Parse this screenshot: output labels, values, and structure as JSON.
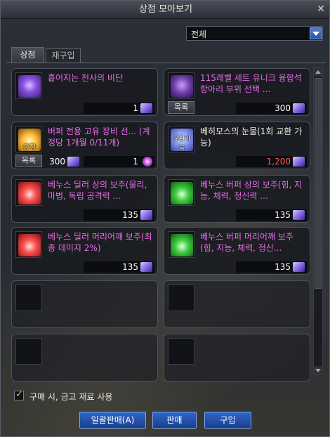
{
  "window": {
    "title": "상점 모아보기"
  },
  "filter": {
    "value": "전체"
  },
  "tabs": [
    {
      "label": "상점"
    },
    {
      "label": "재구입"
    }
  ],
  "items": [
    {
      "name": "흩어지는 천사의 비단",
      "price": "1",
      "icon": "angel-silk-icon"
    },
    {
      "name": "115레벨 세트 유니크 융합석 항아리 부위 선택 ...",
      "price": "300",
      "list_label": "목록",
      "icon": "fusion-stone-jar-icon"
    },
    {
      "name": "버퍼 전용 고유 장비 선... (계정당 1개월 0/11개)",
      "price": "1",
      "list_label": "목록",
      "left_price": "300",
      "icon_label": "한정",
      "icon": "buffer-equipment-chest-icon"
    },
    {
      "name": "베히모스의 눈물(1회 교환 가능)",
      "price": "1,200",
      "icon_label": "교환가능",
      "icon": "behemoth-tear-icon"
    },
    {
      "name": "베누스 딜러 상의 보주(물리, 마법, 독립 공격력 ...",
      "price": "135",
      "icon": "venus-dealer-top-orb-icon"
    },
    {
      "name": "베누스 버퍼 상의 보주(힘, 지능, 체력, 정신력 ...",
      "price": "135",
      "icon": "venus-buffer-top-orb-icon"
    },
    {
      "name": "베누스 딜러 머리어깨 보주(최종 데미지 2%)",
      "price": "135",
      "icon": "venus-dealer-shoulder-orb-icon"
    },
    {
      "name": "베누스 버퍼 머리어깨 보주(힘, 지능, 체력, 정신...",
      "price": "135",
      "icon": "venus-buffer-shoulder-orb-icon"
    }
  ],
  "options": {
    "use_vault_materials": "구매 시, 금고 재료 사용",
    "use_vault_checked": true
  },
  "buttons": {
    "bulk_sell": "일괄판매(A)",
    "sell": "판매",
    "buy": "구입"
  },
  "colors": {
    "item_name": "#e86ce8",
    "price_red": "#ff5a5a",
    "button_blue": "#2f66c8"
  }
}
